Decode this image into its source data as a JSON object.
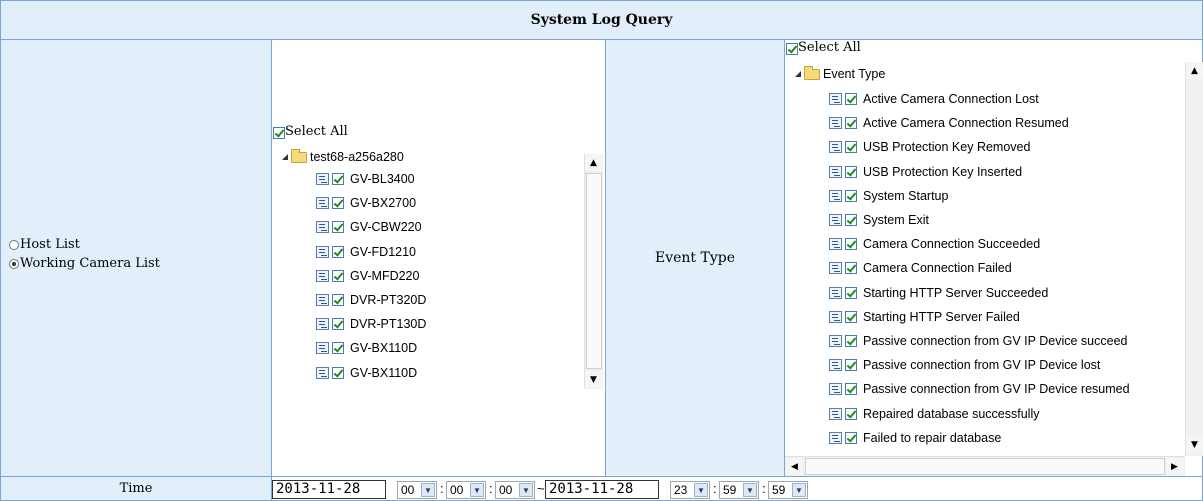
{
  "title": "System Log Query",
  "source": {
    "options": [
      {
        "label": "Host List",
        "selected": false
      },
      {
        "label": "Working Camera List",
        "selected": true
      }
    ]
  },
  "cameras": {
    "select_all": "Select All",
    "root": "test68-a256a280",
    "items": [
      "GV-BL3400",
      "GV-BX2700",
      "GV-CBW220",
      "GV-FD1210",
      "GV-MFD220",
      "DVR-PT320D",
      "DVR-PT130D",
      "GV-BX110D",
      "GV-BX110D"
    ]
  },
  "event_label": "Event Type",
  "events": {
    "select_all": "Select All",
    "root": "Event Type",
    "items": [
      "Active Camera Connection Lost",
      "Active Camera Connection Resumed",
      "USB Protection Key Removed",
      "USB Protection Key Inserted",
      "System Startup",
      "System Exit",
      "Camera Connection Succeeded",
      "Camera Connection Failed",
      "Starting HTTP Server Succeeded",
      "Starting HTTP Server Failed",
      "Passive connection from GV IP Device succeed",
      "Passive connection from GV IP Device lost",
      "Passive connection from GV IP Device resumed",
      "Repaired database successfully",
      "Failed to repair database"
    ]
  },
  "time": {
    "label": "Time",
    "start_date": "2013-11-28",
    "start_hour": "00",
    "start_min": "00",
    "start_sec": "00",
    "range_sep": "~",
    "end_date": "2013-11-28",
    "end_hour": "23",
    "end_min": "59",
    "end_sec": "59",
    "colon": ":"
  },
  "colors": {
    "accent": "#e2effb",
    "border": "#7ea6d3",
    "check": "#1e8a1e"
  }
}
